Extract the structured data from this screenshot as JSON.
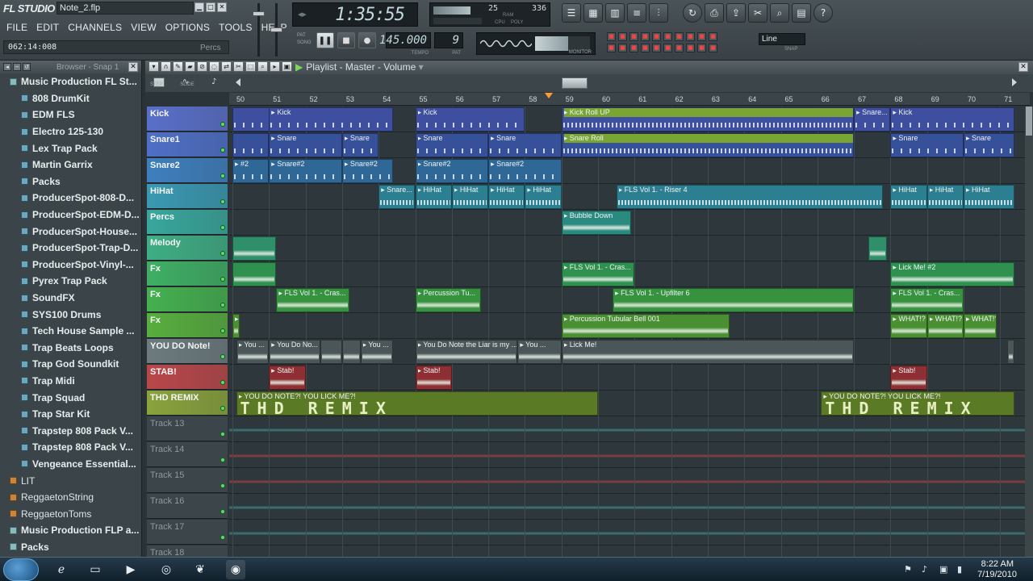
{
  "window": {
    "app_name": "FL STUDIO",
    "file_name": "Note_2.flp"
  },
  "menu": [
    "FILE",
    "EDIT",
    "CHANNELS",
    "VIEW",
    "OPTIONS",
    "TOOLS",
    "HELP"
  ],
  "status": {
    "position": "062:14:008",
    "hint": "Percs"
  },
  "transport": {
    "time": "1:35:55",
    "tempo": "145.000",
    "tempo_label": "TEMPO",
    "pattern": "9",
    "pattern_label": "PAT",
    "mode_pat": "PAT",
    "mode_song": "SONG",
    "cpu_value": "25",
    "poly_value": "336",
    "ram_label": "RAM",
    "cpu_label": "CPU",
    "poly_label": "POLY",
    "monitor_label": "MONITOR",
    "snap_value": "Line",
    "snap_label": "SNAP"
  },
  "browser": {
    "title": "Browser - Snap 1",
    "items": [
      {
        "label": "Music Production FL St...",
        "kind": "root"
      },
      {
        "label": "808 DrumKit",
        "kind": "folder"
      },
      {
        "label": "EDM FLS",
        "kind": "folder"
      },
      {
        "label": "Electro 125-130",
        "kind": "folder"
      },
      {
        "label": "Lex Trap Pack",
        "kind": "folder"
      },
      {
        "label": "Martin Garrix",
        "kind": "folder"
      },
      {
        "label": "Packs",
        "kind": "folder"
      },
      {
        "label": "ProducerSpot-808-D...",
        "kind": "folder"
      },
      {
        "label": "ProducerSpot-EDM-D...",
        "kind": "folder"
      },
      {
        "label": "ProducerSpot-House...",
        "kind": "folder"
      },
      {
        "label": "ProducerSpot-Trap-D...",
        "kind": "folder"
      },
      {
        "label": "ProducerSpot-Vinyl-...",
        "kind": "folder"
      },
      {
        "label": "Pyrex Trap Pack",
        "kind": "folder"
      },
      {
        "label": "SoundFX",
        "kind": "folder"
      },
      {
        "label": "SYS100 Drums",
        "kind": "folder"
      },
      {
        "label": "Tech House Sample ...",
        "kind": "folder"
      },
      {
        "label": "Trap Beats Loops",
        "kind": "folder"
      },
      {
        "label": "Trap God Soundkit",
        "kind": "folder"
      },
      {
        "label": "Trap Midi",
        "kind": "folder"
      },
      {
        "label": "Trap Squad",
        "kind": "folder"
      },
      {
        "label": "Trap Star Kit",
        "kind": "folder"
      },
      {
        "label": "Trapstep 808 Pack V...",
        "kind": "folder"
      },
      {
        "label": "Trapstep 808 Pack V...",
        "kind": "folder"
      },
      {
        "label": "Vengeance Essential...",
        "kind": "folder"
      },
      {
        "label": "LIT",
        "kind": "plain"
      },
      {
        "label": "ReggaetonString",
        "kind": "plain"
      },
      {
        "label": "ReggaetonToms",
        "kind": "plain"
      },
      {
        "label": "Music Production FLP a...",
        "kind": "root"
      },
      {
        "label": "Packs",
        "kind": "root"
      }
    ]
  },
  "playlist": {
    "title": "Playlist - Master - Volume",
    "step_label": "STEP",
    "slide_label": "SLIDE",
    "bars": [
      "50",
      "51",
      "52",
      "53",
      "54",
      "55",
      "56",
      "57",
      "58",
      "59",
      "60",
      "61",
      "62",
      "63",
      "64",
      "65",
      "66",
      "67",
      "68",
      "69",
      "70",
      "71"
    ],
    "tracks": [
      {
        "name": "Kick",
        "color": "#5a6fc9"
      },
      {
        "name": "Snare1",
        "color": "#4f6fc7"
      },
      {
        "name": "Snare2",
        "color": "#3f7fbe"
      },
      {
        "name": "HiHat",
        "color": "#3a99b2"
      },
      {
        "name": "Percs",
        "color": "#38a79c"
      },
      {
        "name": "Melody",
        "color": "#3fae84"
      },
      {
        "name": "Fx",
        "color": "#3faf64"
      },
      {
        "name": "Fx",
        "color": "#45b04f"
      },
      {
        "name": "Fx",
        "color": "#58ae3e"
      },
      {
        "name": "YOU DO Note!",
        "color": "#6d7a7e"
      },
      {
        "name": "STAB!",
        "color": "#b9474a"
      },
      {
        "name": "THD REMIX",
        "color": "#8aa33c"
      },
      {
        "name": "Track 13",
        "color": ""
      },
      {
        "name": "Track 14",
        "color": ""
      },
      {
        "name": "Track 15",
        "color": ""
      },
      {
        "name": "Track 16",
        "color": ""
      },
      {
        "name": "Track 17",
        "color": ""
      },
      {
        "name": "Track 18",
        "color": ""
      }
    ],
    "clips": [
      {
        "lane": 0,
        "start": 50.0,
        "end": 54.4,
        "label": "",
        "color": "#3d4f9e"
      },
      {
        "lane": 0,
        "start": 51.0,
        "end": 54.4,
        "label": "Kick",
        "color": "#3d4f9e"
      },
      {
        "lane": 0,
        "start": 55.0,
        "end": 58.0,
        "label": "Kick",
        "color": "#3d4f9e"
      },
      {
        "lane": 0,
        "start": 59.0,
        "end": 67.0,
        "label": "Kick Roll UP",
        "color": "#3d4f9e",
        "title_color": "#78a533"
      },
      {
        "lane": 0,
        "start": 67.0,
        "end": 68.0,
        "label": "Snare...",
        "color": "#3d4f9e"
      },
      {
        "lane": 0,
        "start": 68.0,
        "end": 71.4,
        "label": "Kick",
        "color": "#3d4f9e"
      },
      {
        "lane": 1,
        "start": 50.0,
        "end": 51.0,
        "label": "",
        "color": "#37509a"
      },
      {
        "lane": 1,
        "start": 51.0,
        "end": 53.0,
        "label": "Snare",
        "color": "#37509a"
      },
      {
        "lane": 1,
        "start": 53.0,
        "end": 54.0,
        "label": "Snare",
        "color": "#37509a"
      },
      {
        "lane": 1,
        "start": 55.0,
        "end": 57.0,
        "label": "Snare",
        "color": "#37509a"
      },
      {
        "lane": 1,
        "start": 57.0,
        "end": 59.0,
        "label": "Snare",
        "color": "#37509a"
      },
      {
        "lane": 1,
        "start": 59.0,
        "end": 67.0,
        "label": "Snare Roll",
        "color": "#37509a",
        "title_color": "#78a533"
      },
      {
        "lane": 1,
        "start": 68.0,
        "end": 70.0,
        "label": "Snare",
        "color": "#37509a"
      },
      {
        "lane": 1,
        "start": 70.0,
        "end": 71.4,
        "label": "Snare",
        "color": "#37509a"
      },
      {
        "lane": 2,
        "start": 50.0,
        "end": 51.0,
        "label": "#2",
        "color": "#2f6897"
      },
      {
        "lane": 2,
        "start": 51.0,
        "end": 53.0,
        "label": "Snare#2",
        "color": "#2f6897"
      },
      {
        "lane": 2,
        "start": 53.0,
        "end": 54.4,
        "label": "Snare#2",
        "color": "#2f6897"
      },
      {
        "lane": 2,
        "start": 55.0,
        "end": 57.0,
        "label": "Snare#2",
        "color": "#2f6897"
      },
      {
        "lane": 2,
        "start": 57.0,
        "end": 59.0,
        "label": "Snare#2",
        "color": "#2f6897"
      },
      {
        "lane": 3,
        "start": 54.0,
        "end": 55.0,
        "label": "Snare...",
        "color": "#2c7f91"
      },
      {
        "lane": 3,
        "start": 55.0,
        "end": 56.0,
        "label": "HiHat",
        "color": "#2c7f91"
      },
      {
        "lane": 3,
        "start": 56.0,
        "end": 57.0,
        "label": "HiHat",
        "color": "#2c7f91"
      },
      {
        "lane": 3,
        "start": 57.0,
        "end": 58.0,
        "label": "HiHat",
        "color": "#2c7f91"
      },
      {
        "lane": 3,
        "start": 58.0,
        "end": 59.0,
        "label": "HiHat",
        "color": "#2c7f91"
      },
      {
        "lane": 3,
        "start": 60.5,
        "end": 67.8,
        "label": "FLS Vol 1. - Riser 4",
        "color": "#2c7f91"
      },
      {
        "lane": 3,
        "start": 68.0,
        "end": 69.0,
        "label": "HiHat",
        "color": "#2c7f91"
      },
      {
        "lane": 3,
        "start": 69.0,
        "end": 70.0,
        "label": "HiHat",
        "color": "#2c7f91"
      },
      {
        "lane": 3,
        "start": 70.0,
        "end": 71.4,
        "label": "HiHat",
        "color": "#2c7f91"
      },
      {
        "lane": 4,
        "start": 59.0,
        "end": 60.9,
        "label": "Bubble Down",
        "color": "#2b8a7f"
      },
      {
        "lane": 5,
        "start": 50.0,
        "end": 51.2,
        "label": "",
        "color": "#2f8f6a"
      },
      {
        "lane": 5,
        "start": 67.4,
        "end": 67.9,
        "label": "",
        "color": "#2f8f6a"
      },
      {
        "lane": 6,
        "start": 50.0,
        "end": 51.2,
        "label": "",
        "color": "#2f9150"
      },
      {
        "lane": 6,
        "start": 59.0,
        "end": 61.0,
        "label": "FLS Vol 1. - Cras...",
        "color": "#2f9150"
      },
      {
        "lane": 6,
        "start": 68.0,
        "end": 71.4,
        "label": "Lick Me! #2",
        "color": "#2f9150"
      },
      {
        "lane": 7,
        "start": 51.2,
        "end": 53.2,
        "label": "FLS Vol 1. - Cras...",
        "color": "#379240"
      },
      {
        "lane": 7,
        "start": 55.0,
        "end": 56.8,
        "label": "Percussion Tu...",
        "color": "#379240"
      },
      {
        "lane": 7,
        "start": 60.4,
        "end": 67.0,
        "label": "FLS Vol 1. - Upfilter 6",
        "color": "#379240"
      },
      {
        "lane": 7,
        "start": 68.0,
        "end": 70.0,
        "label": "FLS Vol 1. - Cras...",
        "color": "#379240"
      },
      {
        "lane": 8,
        "start": 50.0,
        "end": 50.2,
        "label": "?",
        "color": "#4a9033"
      },
      {
        "lane": 8,
        "start": 59.0,
        "end": 63.6,
        "label": "Percussion Tubular Bell 001",
        "color": "#4a9033"
      },
      {
        "lane": 8,
        "start": 68.0,
        "end": 69.0,
        "label": "WHAT!?",
        "color": "#4a9033"
      },
      {
        "lane": 8,
        "start": 69.0,
        "end": 70.0,
        "label": "WHAT!?",
        "color": "#4a9033"
      },
      {
        "lane": 8,
        "start": 70.0,
        "end": 70.9,
        "label": "WHAT!?",
        "color": "#4a9033"
      },
      {
        "lane": 9,
        "start": 50.1,
        "end": 51.0,
        "label": "You ...",
        "color": "#4b5659"
      },
      {
        "lane": 9,
        "start": 51.0,
        "end": 52.4,
        "label": "You Do No...",
        "color": "#4b5659"
      },
      {
        "lane": 9,
        "start": 52.4,
        "end": 53.0,
        "label": "",
        "color": "#4b5659"
      },
      {
        "lane": 9,
        "start": 53.0,
        "end": 53.5,
        "label": "",
        "color": "#4b5659"
      },
      {
        "lane": 9,
        "start": 53.5,
        "end": 54.4,
        "label": "You ...",
        "color": "#4b5659"
      },
      {
        "lane": 9,
        "start": 55.0,
        "end": 57.8,
        "label": "You Do Note the Liar is my ...",
        "color": "#4b5659"
      },
      {
        "lane": 9,
        "start": 57.8,
        "end": 59.0,
        "label": "You ...",
        "color": "#4b5659"
      },
      {
        "lane": 9,
        "start": 59.0,
        "end": 67.0,
        "label": "Lick Me!",
        "color": "#4b5659"
      },
      {
        "lane": 9,
        "start": 71.2,
        "end": 71.4,
        "label": "",
        "color": "#4b5659"
      },
      {
        "lane": 10,
        "start": 51.0,
        "end": 52.0,
        "label": "Stab!",
        "color": "#8d2f33"
      },
      {
        "lane": 10,
        "start": 55.0,
        "end": 56.0,
        "label": "Stab!",
        "color": "#8d2f33"
      },
      {
        "lane": 10,
        "start": 68.0,
        "end": 69.0,
        "label": "Stab!",
        "color": "#8d2f33"
      },
      {
        "lane": 11,
        "start": 50.1,
        "end": 60.0,
        "label": "YOU DO NOTE?! YOU LICK ME?!",
        "color": "#5b7a26"
      },
      {
        "lane": 11,
        "start": 66.1,
        "end": 71.4,
        "label": "YOU DO NOTE?! YOU LICK ME?!",
        "color": "#5b7a26"
      }
    ],
    "remix_text": "THD REMIX"
  },
  "taskbar": {
    "time": "8:22 AM",
    "date": "7/19/2010"
  }
}
